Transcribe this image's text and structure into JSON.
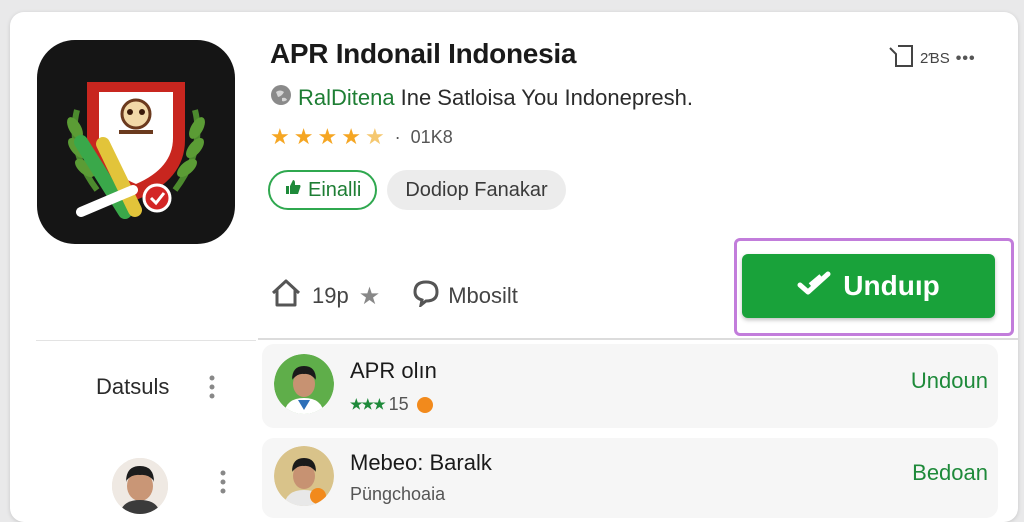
{
  "app": {
    "title": "APR Indonail Indonesia",
    "developer_prefix": "",
    "developer_name": "RalDitena",
    "tagline": "Ine Satloisa You Indonepresh.",
    "rating": {
      "stars": 4.5,
      "meta": "01K8"
    },
    "top_count": "2ƁS"
  },
  "chips": {
    "install_chip": "Einalli",
    "category_chip": "Dodiop Fanakar"
  },
  "stats": {
    "score": "19p",
    "messages_label": "Mbosilt"
  },
  "install_button": {
    "label": "Unduıp"
  },
  "sidebar": {
    "details_label": "Datsuls"
  },
  "list": [
    {
      "name": "APR olın",
      "rating_text": "★★★",
      "count": "15",
      "action": "Undoun"
    },
    {
      "name": "Mebeo: Baralk",
      "subtitle": "Püngchoaia",
      "action": "Bedoan"
    }
  ],
  "colors": {
    "accent_green": "#19a23a",
    "star_color": "#f5a623",
    "highlight_border": "#c27ddb"
  },
  "icons": [
    "app-logo-icon",
    "globe-icon",
    "star-icon",
    "thumbs-up-icon",
    "home-icon",
    "chat-bubble-icon",
    "check-icon",
    "kebab-menu-icon",
    "bookmark-icon",
    "more-icon"
  ]
}
